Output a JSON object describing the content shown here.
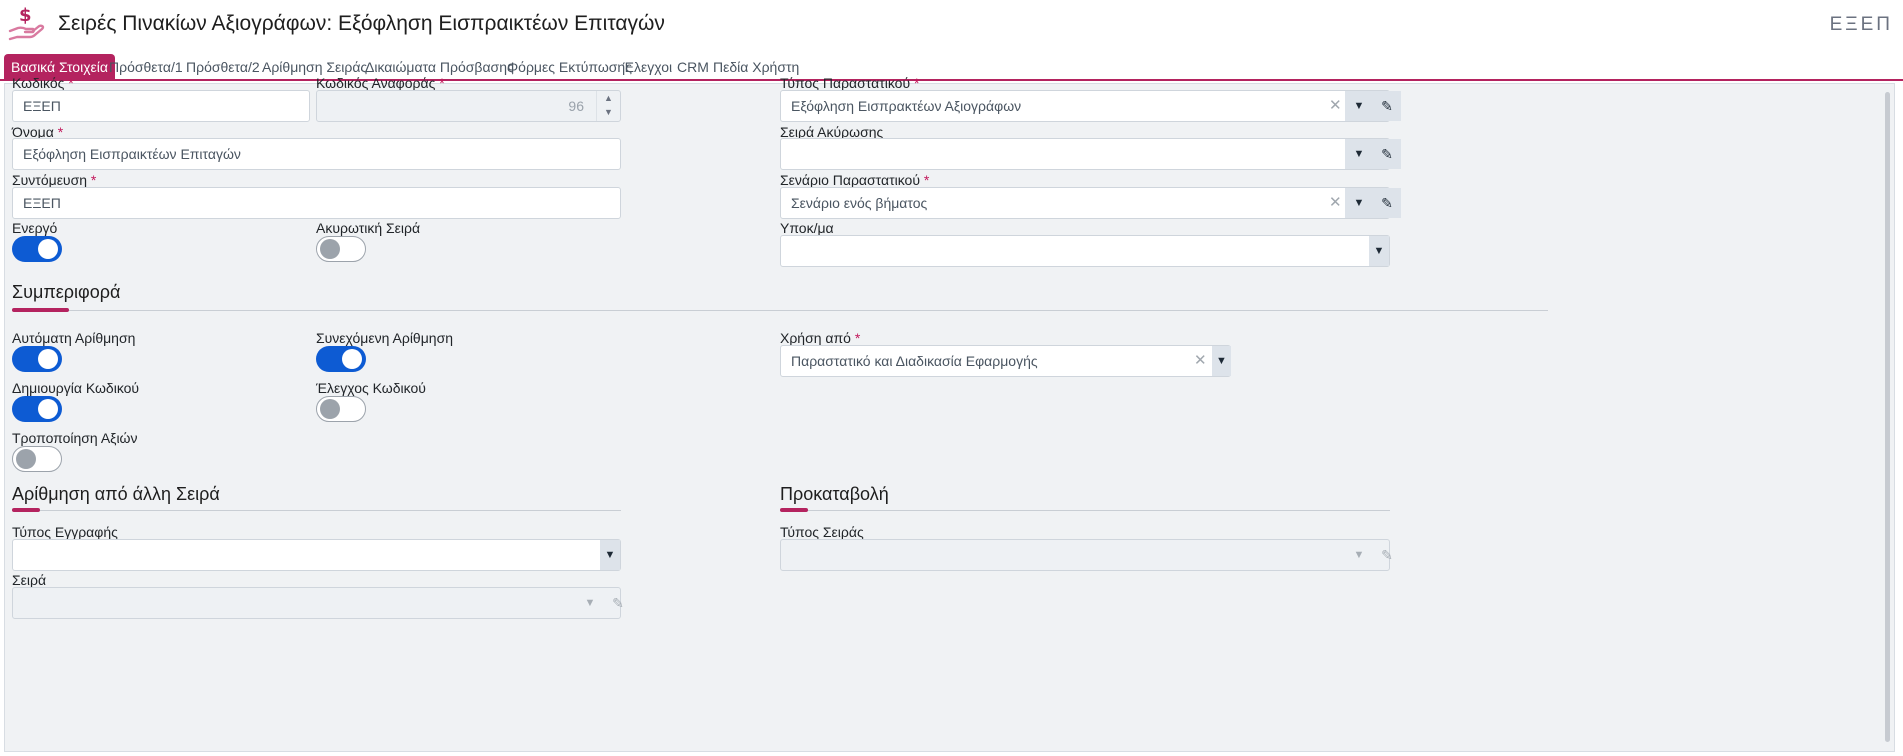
{
  "header": {
    "title": "Σειρές Πινακίων Αξιογράφων: Εξόφληση Εισπραικτέων Επιταγών",
    "code": "ΕΞΕΠ",
    "icon": "hand-money-icon",
    "accent_color": "#b4235f"
  },
  "tabs": [
    {
      "label": "Βασικά Στοιχεία",
      "active": true
    },
    {
      "label": "Πρόσθετα/1"
    },
    {
      "label": "Πρόσθετα/2"
    },
    {
      "label": "Αρίθμηση Σειράς"
    },
    {
      "label": "Δικαιώματα Πρόσβασης"
    },
    {
      "label": "Φόρμες Εκτύπωσης"
    },
    {
      "label": "Έλεγχοι"
    },
    {
      "label": "CRM"
    },
    {
      "label": "Πεδία Χρήστη"
    }
  ],
  "form": {
    "code_label": "Κωδικός",
    "code_value": "ΕΞΕΠ",
    "ref_code_label": "Κωδικός Αναφοράς",
    "ref_code_value": "96",
    "name_label": "Όνομα",
    "name_value": "Εξόφληση Εισπραικτέων Επιταγών",
    "short_label": "Συντόμευση",
    "short_value": "ΕΞΕΠ",
    "active_label": "Ενεργό",
    "active_on": true,
    "cancel_series_toggle_label": "Ακυρωτική Σειρά",
    "cancel_series_toggle_on": false,
    "doc_type_label": "Τύπος Παραστατικού",
    "doc_type_value": "Εξόφληση Εισπρακτέων Αξιογράφων",
    "cancel_series_label": "Σειρά Ακύρωσης",
    "cancel_series_value": "",
    "scenario_label": "Σενάριο Παραστατικού",
    "scenario_value": "Σενάριο ενός βήματος",
    "branch_label": "Υποκ/μα",
    "branch_value": ""
  },
  "behavior": {
    "title": "Συμπεριφορά",
    "auto_numbering_label": "Αυτόματη Αρίθμηση",
    "auto_numbering_on": true,
    "continuous_numbering_label": "Συνεχόμενη Αρίθμηση",
    "continuous_numbering_on": true,
    "create_code_label": "Δημιουργία Κωδικού",
    "create_code_on": true,
    "check_code_label": "Έλεγχος Κωδικού",
    "check_code_on": false,
    "modify_values_label": "Τροποποίηση Αξιών",
    "modify_values_on": false,
    "used_by_label": "Χρήση από",
    "used_by_value": "Παραστατικό και Διαδικασία Εφαρμογής"
  },
  "numbering_from": {
    "title": "Αρίθμηση από άλλη Σειρά",
    "record_type_label": "Τύπος Εγγραφής",
    "record_type_value": "",
    "series_label": "Σειρά",
    "series_value": ""
  },
  "advance": {
    "title": "Προκαταβολή",
    "series_type_label": "Τύπος Σειράς",
    "series_type_value": ""
  }
}
